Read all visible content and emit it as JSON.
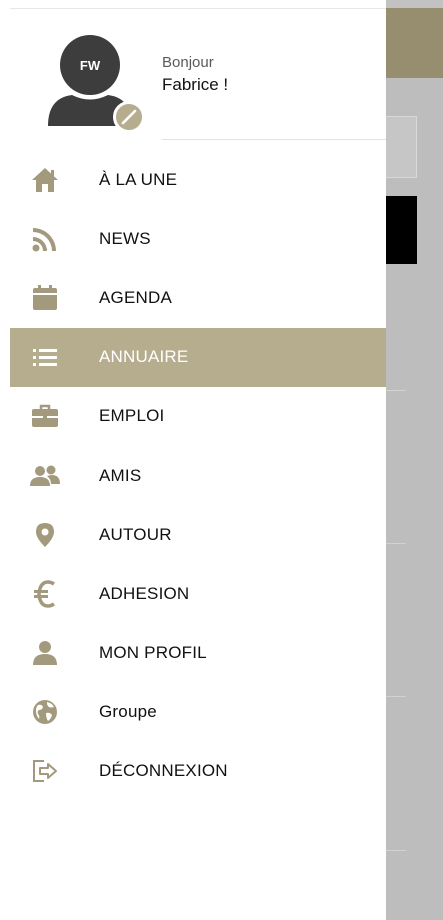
{
  "profile": {
    "initials": "FW",
    "greeting": "Bonjour",
    "name": "Fabrice !"
  },
  "colors": {
    "accent": "#b6ac8e",
    "icon": "#a39a7e",
    "avatar": "#3d3d3d"
  },
  "menu": {
    "items": [
      {
        "label": "À LA UNE",
        "icon": "home-icon",
        "active": false
      },
      {
        "label": "NEWS",
        "icon": "rss-icon",
        "active": false
      },
      {
        "label": "AGENDA",
        "icon": "calendar-icon",
        "active": false
      },
      {
        "label": "ANNUAIRE",
        "icon": "list-icon",
        "active": true
      },
      {
        "label": "EMPLOI",
        "icon": "briefcase-icon",
        "active": false
      },
      {
        "label": "AMIS",
        "icon": "users-icon",
        "active": false
      },
      {
        "label": "AUTOUR",
        "icon": "map-pin-icon",
        "active": false
      },
      {
        "label": "ADHESION",
        "icon": "euro-icon",
        "active": false
      },
      {
        "label": "MON PROFIL",
        "icon": "user-icon",
        "active": false
      },
      {
        "label": "Groupe",
        "icon": "globe-icon",
        "active": false
      },
      {
        "label": "DÉCONNEXION",
        "icon": "logout-icon",
        "active": false
      }
    ]
  }
}
